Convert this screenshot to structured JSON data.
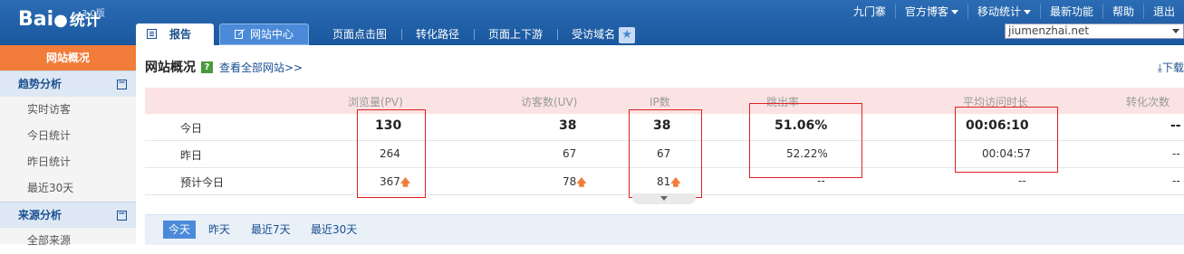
{
  "app": {
    "logo_text": "Bai",
    "logo_suffix": "统计",
    "version": "3.0版"
  },
  "top_links": [
    "九门寨",
    "官方博客",
    "移动统计",
    "最新功能",
    "帮助",
    "退出"
  ],
  "tabs": {
    "report": "报告",
    "site_center": "网站中心",
    "heatmap": "页面点击图",
    "conversion_path": "转化路径",
    "updown": "页面上下游",
    "domain": "受访域名"
  },
  "site_select": {
    "value": "jiumenzhai.net"
  },
  "sidebar": {
    "active": "网站概况",
    "trend_group": "趋势分析",
    "trend_items": [
      "实时访客",
      "今日统计",
      "昨日统计",
      "最近30天"
    ],
    "source_group": "来源分析",
    "source_items": [
      "全部来源"
    ]
  },
  "main": {
    "title": "网站概况",
    "help": "?",
    "view_all": "查看全部网站>>",
    "download": "下载"
  },
  "table": {
    "headers": [
      "浏览量(PV)",
      "访客数(UV)",
      "IP数",
      "跳出率",
      "平均访问时长",
      "转化次数"
    ],
    "rows": [
      {
        "label": "今日",
        "pv": "130",
        "uv": "38",
        "ip": "38",
        "bounce": "51.06%",
        "avg": "00:06:10",
        "conv": "--"
      },
      {
        "label": "昨日",
        "pv": "264",
        "uv": "67",
        "ip": "67",
        "bounce": "52.22%",
        "avg": "00:04:57",
        "conv": "--"
      },
      {
        "label": "预计今日",
        "pv": "367",
        "uv": "78",
        "ip": "81",
        "bounce": "--",
        "avg": "--",
        "conv": "--"
      }
    ],
    "up_arrow": "🡅"
  },
  "ranges": [
    "今天",
    "昨天",
    "最近7天",
    "最近30天"
  ],
  "colors": {
    "topbar": "#1e5fa8",
    "active_sidebar": "#f27c3a",
    "header_bg": "#fbe3e3",
    "highlight_box": "#e02020"
  }
}
